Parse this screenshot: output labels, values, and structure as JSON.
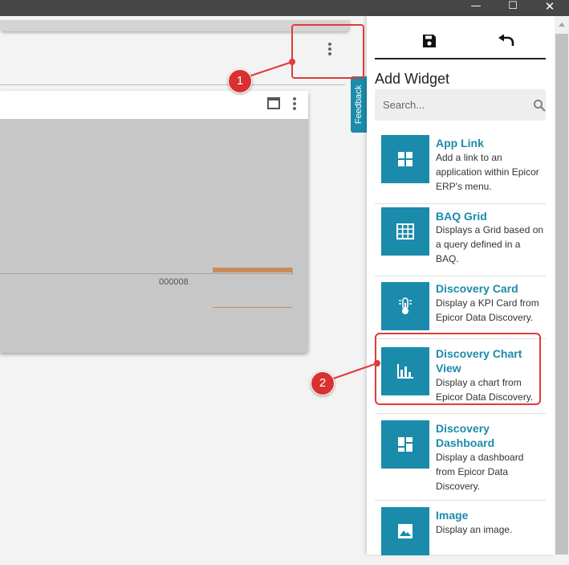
{
  "window": {
    "minimize_glyph": "—",
    "maximize_glyph": "☐",
    "close_glyph": "✕"
  },
  "chart": {
    "tick_label": "000008"
  },
  "feedback": {
    "label": "Feedback"
  },
  "panel": {
    "title": "Add Widget",
    "search_placeholder": "Search...",
    "actions": [
      "save-icon",
      "undo-icon"
    ],
    "widgets": [
      {
        "name": "App Link",
        "description": "Add a link to an application within Epicor ERP's menu.",
        "icon": "apps-grid-icon"
      },
      {
        "name": "BAQ Grid",
        "description": "Displays a Grid based on a query defined in a BAQ.",
        "icon": "table-grid-icon"
      },
      {
        "name": "Discovery Card",
        "description": "Display a KPI Card from Epicor Data Discovery.",
        "icon": "thermometer-icon"
      },
      {
        "name": "Discovery Chart View",
        "description": "Display a chart from Epicor Data Discovery.",
        "icon": "bar-chart-icon"
      },
      {
        "name": "Discovery Dashboard",
        "description": "Display a dashboard from Epicor Data Discovery.",
        "icon": "dashboard-icon"
      },
      {
        "name": "Image",
        "description": "Display an image.",
        "icon": "image-icon"
      }
    ]
  },
  "annotations": {
    "callout_1": "1",
    "callout_2": "2"
  },
  "colors": {
    "accent": "#1b8bab",
    "annotation_red": "#e23a3a",
    "titlebar": "#464646",
    "chart_bar": "#c88c5b"
  }
}
